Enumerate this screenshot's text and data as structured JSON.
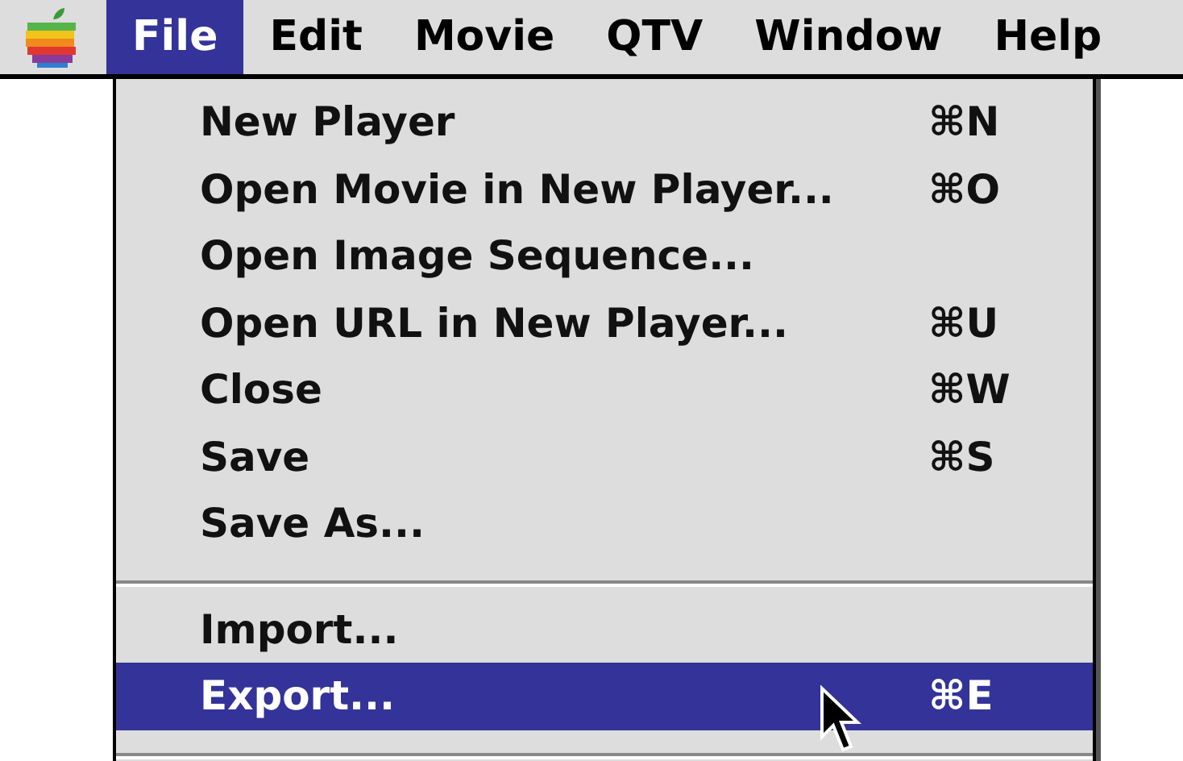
{
  "menu_bar": {
    "items": [
      {
        "label": "File",
        "selected": true
      },
      {
        "label": "Edit",
        "selected": false
      },
      {
        "label": "Movie",
        "selected": false
      },
      {
        "label": "QTV",
        "selected": false
      },
      {
        "label": "Window",
        "selected": false
      },
      {
        "label": "Help",
        "selected": false
      }
    ]
  },
  "file_menu": {
    "items": [
      {
        "kind": "item",
        "label": "New Player",
        "shortcut": "⌘N",
        "selected": false
      },
      {
        "kind": "item",
        "label": "Open Movie in New Player...",
        "shortcut": "⌘O",
        "selected": false
      },
      {
        "kind": "item",
        "label": "Open Image Sequence...",
        "selected": false
      },
      {
        "kind": "item",
        "label": "Open URL in New Player...",
        "shortcut": "⌘U",
        "selected": false
      },
      {
        "kind": "item",
        "label": "Close",
        "shortcut": "⌘W",
        "selected": false
      },
      {
        "kind": "item",
        "label": "Save",
        "shortcut": "⌘S",
        "selected": false
      },
      {
        "kind": "item",
        "label": "Save As...",
        "selected": false
      },
      {
        "kind": "separator"
      },
      {
        "kind": "item",
        "label": "Import...",
        "selected": false
      },
      {
        "kind": "item",
        "label": "Export...",
        "shortcut": "⌘E",
        "selected": true
      },
      {
        "kind": "separator"
      }
    ]
  }
}
